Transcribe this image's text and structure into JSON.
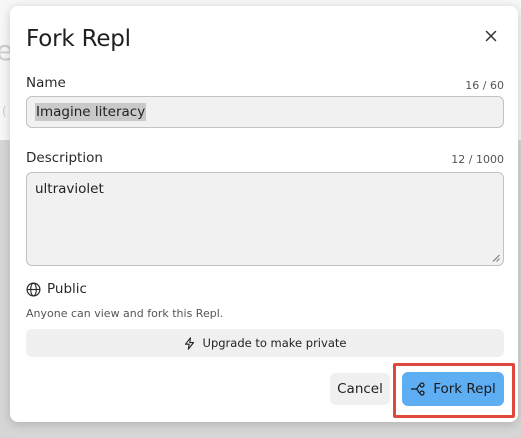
{
  "background": {
    "fragment_large": "e",
    "fragment_small": "("
  },
  "dialog": {
    "title": "Fork Repl",
    "close_icon": "close-icon"
  },
  "name_field": {
    "label": "Name",
    "counter": "16 / 60",
    "value": "Imagine literacy"
  },
  "description_field": {
    "label": "Description",
    "counter": "12 / 1000",
    "value": "ultraviolet"
  },
  "visibility": {
    "icon": "globe-icon",
    "label": "Public",
    "description": "Anyone can view and fork this Repl."
  },
  "upgrade": {
    "icon": "lightning-icon",
    "label": "Upgrade to make private"
  },
  "actions": {
    "cancel_label": "Cancel",
    "fork_label": "Fork Repl",
    "fork_icon": "fork-icon"
  },
  "colors": {
    "primary_button": "#5eaef4",
    "highlight_border": "#e0483d"
  }
}
